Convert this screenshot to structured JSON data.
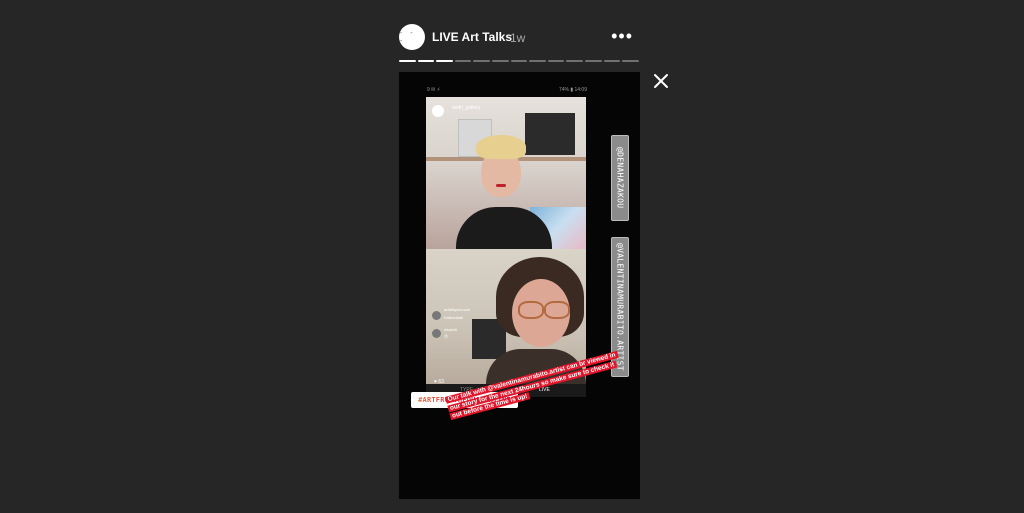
{
  "header": {
    "avatar_text": "- - -",
    "author": "LIVE Art Talks",
    "age": "1w",
    "more_icon": "more-horizontal-icon",
    "more_glyph": "•••"
  },
  "progress": {
    "total_segments": 13,
    "completed_segments": 3
  },
  "close_icon": "close-icon",
  "story": {
    "status_left": "9 ✉ ⚡",
    "status_right": "74% ▮ 14:09",
    "live_username": "vedri_gallery",
    "live_subtitle": "went live 1 h ago",
    "comments": [
      {
        "user": "artistbymoruzh",
        "text": "Katheddall"
      },
      {
        "user": "mkaruli",
        "text": "😍"
      }
    ],
    "viewers": "♥ 63",
    "more_label": "More",
    "tabs": [
      "TYPE",
      "LIVE"
    ],
    "sticker_1": "@DENAHAZAKOU",
    "sticker_2": "@VALENTINAMURABITO.ARTIST",
    "hashtag": "#ARTFROMTHEQUARANTINE",
    "caption": "Our talk with @valentinamurabito.artist can br viewed in our story for the next 24hours so make sure to check it out before the time is up!"
  },
  "colors": {
    "background": "#262626",
    "caption_bg": "#e0152a",
    "close": "#ffffff"
  }
}
